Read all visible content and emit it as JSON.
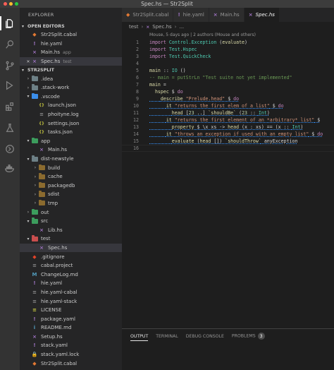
{
  "window": {
    "title": "Spec.hs — Str2Split"
  },
  "activity_bar": [
    "explorer-icon",
    "search-icon",
    "source-control-icon",
    "debug-icon",
    "extensions-icon",
    "test-icon",
    "remote-icon",
    "docker-icon"
  ],
  "sidebar": {
    "title": "EXPLORER",
    "open_editors": {
      "label": "OPEN EDITORS",
      "items": [
        {
          "name": "Str2Split.cabal",
          "desc": "",
          "icon": "cabal-icon",
          "color": "#e37933"
        },
        {
          "name": "hie.yaml",
          "desc": "",
          "icon": "yaml-icon",
          "color": "#a074c4"
        },
        {
          "name": "Main.hs",
          "desc": "app",
          "icon": "haskell-icon",
          "color": "#a074c4"
        },
        {
          "name": "Spec.hs",
          "desc": "test",
          "icon": "haskell-icon",
          "color": "#a074c4"
        }
      ]
    },
    "project": {
      "label": "STR2SPLIT",
      "tree": [
        {
          "name": ".idea",
          "depth": 1,
          "kind": "folder",
          "open": false,
          "color": "#6d8086"
        },
        {
          "name": ".stack-work",
          "depth": 1,
          "kind": "folder",
          "open": false,
          "color": "#6d8086"
        },
        {
          "name": ".vscode",
          "depth": 1,
          "kind": "folder",
          "open": true,
          "color": "#3b8eea"
        },
        {
          "name": "launch.json",
          "depth": 2,
          "kind": "file",
          "icon": "debug-json-icon",
          "color": "#cbcb41"
        },
        {
          "name": "phoityne.log",
          "depth": 2,
          "kind": "file",
          "icon": "log-icon",
          "color": "#8b8b8b"
        },
        {
          "name": "settings.json",
          "depth": 2,
          "kind": "file",
          "icon": "json-icon",
          "color": "#cbcb41"
        },
        {
          "name": "tasks.json",
          "depth": 2,
          "kind": "file",
          "icon": "json-icon",
          "color": "#cbcb41"
        },
        {
          "name": "app",
          "depth": 1,
          "kind": "folder",
          "open": true,
          "color": "#3c9d5d"
        },
        {
          "name": "Main.hs",
          "depth": 2,
          "kind": "file",
          "icon": "haskell-icon",
          "color": "#a074c4"
        },
        {
          "name": "dist-newstyle",
          "depth": 1,
          "kind": "folder",
          "open": true,
          "color": "#6d8086"
        },
        {
          "name": "build",
          "depth": 2,
          "kind": "folder",
          "open": false,
          "color": "#8b6b2f"
        },
        {
          "name": "cache",
          "depth": 2,
          "kind": "folder",
          "open": false,
          "color": "#8b6b2f"
        },
        {
          "name": "packagedb",
          "depth": 2,
          "kind": "folder",
          "open": false,
          "color": "#8b6b2f"
        },
        {
          "name": "sdist",
          "depth": 2,
          "kind": "folder",
          "open": false,
          "color": "#8b6b2f"
        },
        {
          "name": "tmp",
          "depth": 2,
          "kind": "folder",
          "open": false,
          "color": "#8b6b2f"
        },
        {
          "name": "out",
          "depth": 1,
          "kind": "folder",
          "open": false,
          "color": "#3c9d5d"
        },
        {
          "name": "src",
          "depth": 1,
          "kind": "folder",
          "open": true,
          "color": "#3c9d5d"
        },
        {
          "name": "Lib.hs",
          "depth": 2,
          "kind": "file",
          "icon": "haskell-icon",
          "color": "#a074c4"
        },
        {
          "name": "test",
          "depth": 1,
          "kind": "folder",
          "open": true,
          "color": "#c94e4e"
        },
        {
          "name": "Spec.hs",
          "depth": 2,
          "kind": "file",
          "icon": "haskell-icon",
          "color": "#a074c4",
          "selected": true
        },
        {
          "name": ".gitignore",
          "depth": 1,
          "kind": "file",
          "icon": "git-icon",
          "color": "#e24329"
        },
        {
          "name": "cabal.project",
          "depth": 1,
          "kind": "file",
          "icon": "file-icon",
          "color": "#8b8b8b"
        },
        {
          "name": "ChangeLog.md",
          "depth": 1,
          "kind": "file",
          "icon": "markdown-icon",
          "color": "#519aba"
        },
        {
          "name": "hie.yaml",
          "depth": 1,
          "kind": "file",
          "icon": "yaml-icon",
          "color": "#a074c4"
        },
        {
          "name": "hie.yaml-cabal",
          "depth": 1,
          "kind": "file",
          "icon": "file-icon",
          "color": "#8b8b8b"
        },
        {
          "name": "hie.yaml-stack",
          "depth": 1,
          "kind": "file",
          "icon": "file-icon",
          "color": "#8b8b8b"
        },
        {
          "name": "LICENSE",
          "depth": 1,
          "kind": "file",
          "icon": "license-icon",
          "color": "#cbcb41"
        },
        {
          "name": "package.yaml",
          "depth": 1,
          "kind": "file",
          "icon": "yaml-icon",
          "color": "#a074c4"
        },
        {
          "name": "README.md",
          "depth": 1,
          "kind": "file",
          "icon": "info-icon",
          "color": "#519aba"
        },
        {
          "name": "Setup.hs",
          "depth": 1,
          "kind": "file",
          "icon": "haskell-icon",
          "color": "#a074c4"
        },
        {
          "name": "stack.yaml",
          "depth": 1,
          "kind": "file",
          "icon": "yaml-icon",
          "color": "#a074c4"
        },
        {
          "name": "stack.yaml.lock",
          "depth": 1,
          "kind": "file",
          "icon": "lock-icon",
          "color": "#8b8b8b"
        },
        {
          "name": "Str2Split.cabal",
          "depth": 1,
          "kind": "file",
          "icon": "cabal-icon",
          "color": "#e37933"
        }
      ]
    }
  },
  "editor": {
    "tabs": [
      {
        "label": "Str2Split.cabal",
        "active": false,
        "icon": "cabal-icon",
        "color": "#e37933"
      },
      {
        "label": "hie.yaml",
        "active": false,
        "icon": "yaml-icon",
        "color": "#a074c4"
      },
      {
        "label": "Main.hs",
        "active": false,
        "icon": "haskell-icon",
        "color": "#a074c4"
      },
      {
        "label": "Spec.hs",
        "active": true,
        "icon": "haskell-icon",
        "color": "#a074c4"
      }
    ],
    "breadcrumb": [
      "test",
      "Spec.hs",
      "..."
    ],
    "codelens": "Mouse, 5 days ago | 2 authors (Mouse and others)",
    "lines": [
      {
        "n": "1",
        "text": "import Control.Exception (evaluate)"
      },
      {
        "n": "2",
        "text": "import Test.Hspec"
      },
      {
        "n": "3",
        "text": "import Test.QuickCheck"
      },
      {
        "n": "4",
        "text": ""
      },
      {
        "n": "5",
        "text": "main :: IO ()"
      },
      {
        "n": "6",
        "text": "-- main = putStrLn \"Test suite not yet implemented\""
      },
      {
        "n": "7",
        "text": "main ="
      },
      {
        "n": "8",
        "text": "  hspec $ do"
      },
      {
        "n": "9",
        "text": "    describe \"Prelude.head\" $ do"
      },
      {
        "n": "10",
        "text": "      it \"returns the first elem of a list\" $ do"
      },
      {
        "n": "11",
        "text": "        head [23 ..] `shouldBe` (23 :: Int)"
      },
      {
        "n": "12",
        "text": "      it \"returns the first element of an *arbitrary* list\" $"
      },
      {
        "n": "13",
        "text": "        property $ \\x xs -> head (x : xs) == (x :: Int)"
      },
      {
        "n": "14",
        "text": "      it \"throws an exception if used with an empty list\" $ do"
      },
      {
        "n": "15",
        "text": "        evaluate (head []) `shouldThrow` anyException"
      },
      {
        "n": "16",
        "text": ""
      }
    ]
  },
  "panel": {
    "tabs": [
      "OUTPUT",
      "TERMINAL",
      "DEBUG CONSOLE",
      "PROBLEMS"
    ],
    "active": "OUTPUT",
    "problems_count": "3"
  }
}
